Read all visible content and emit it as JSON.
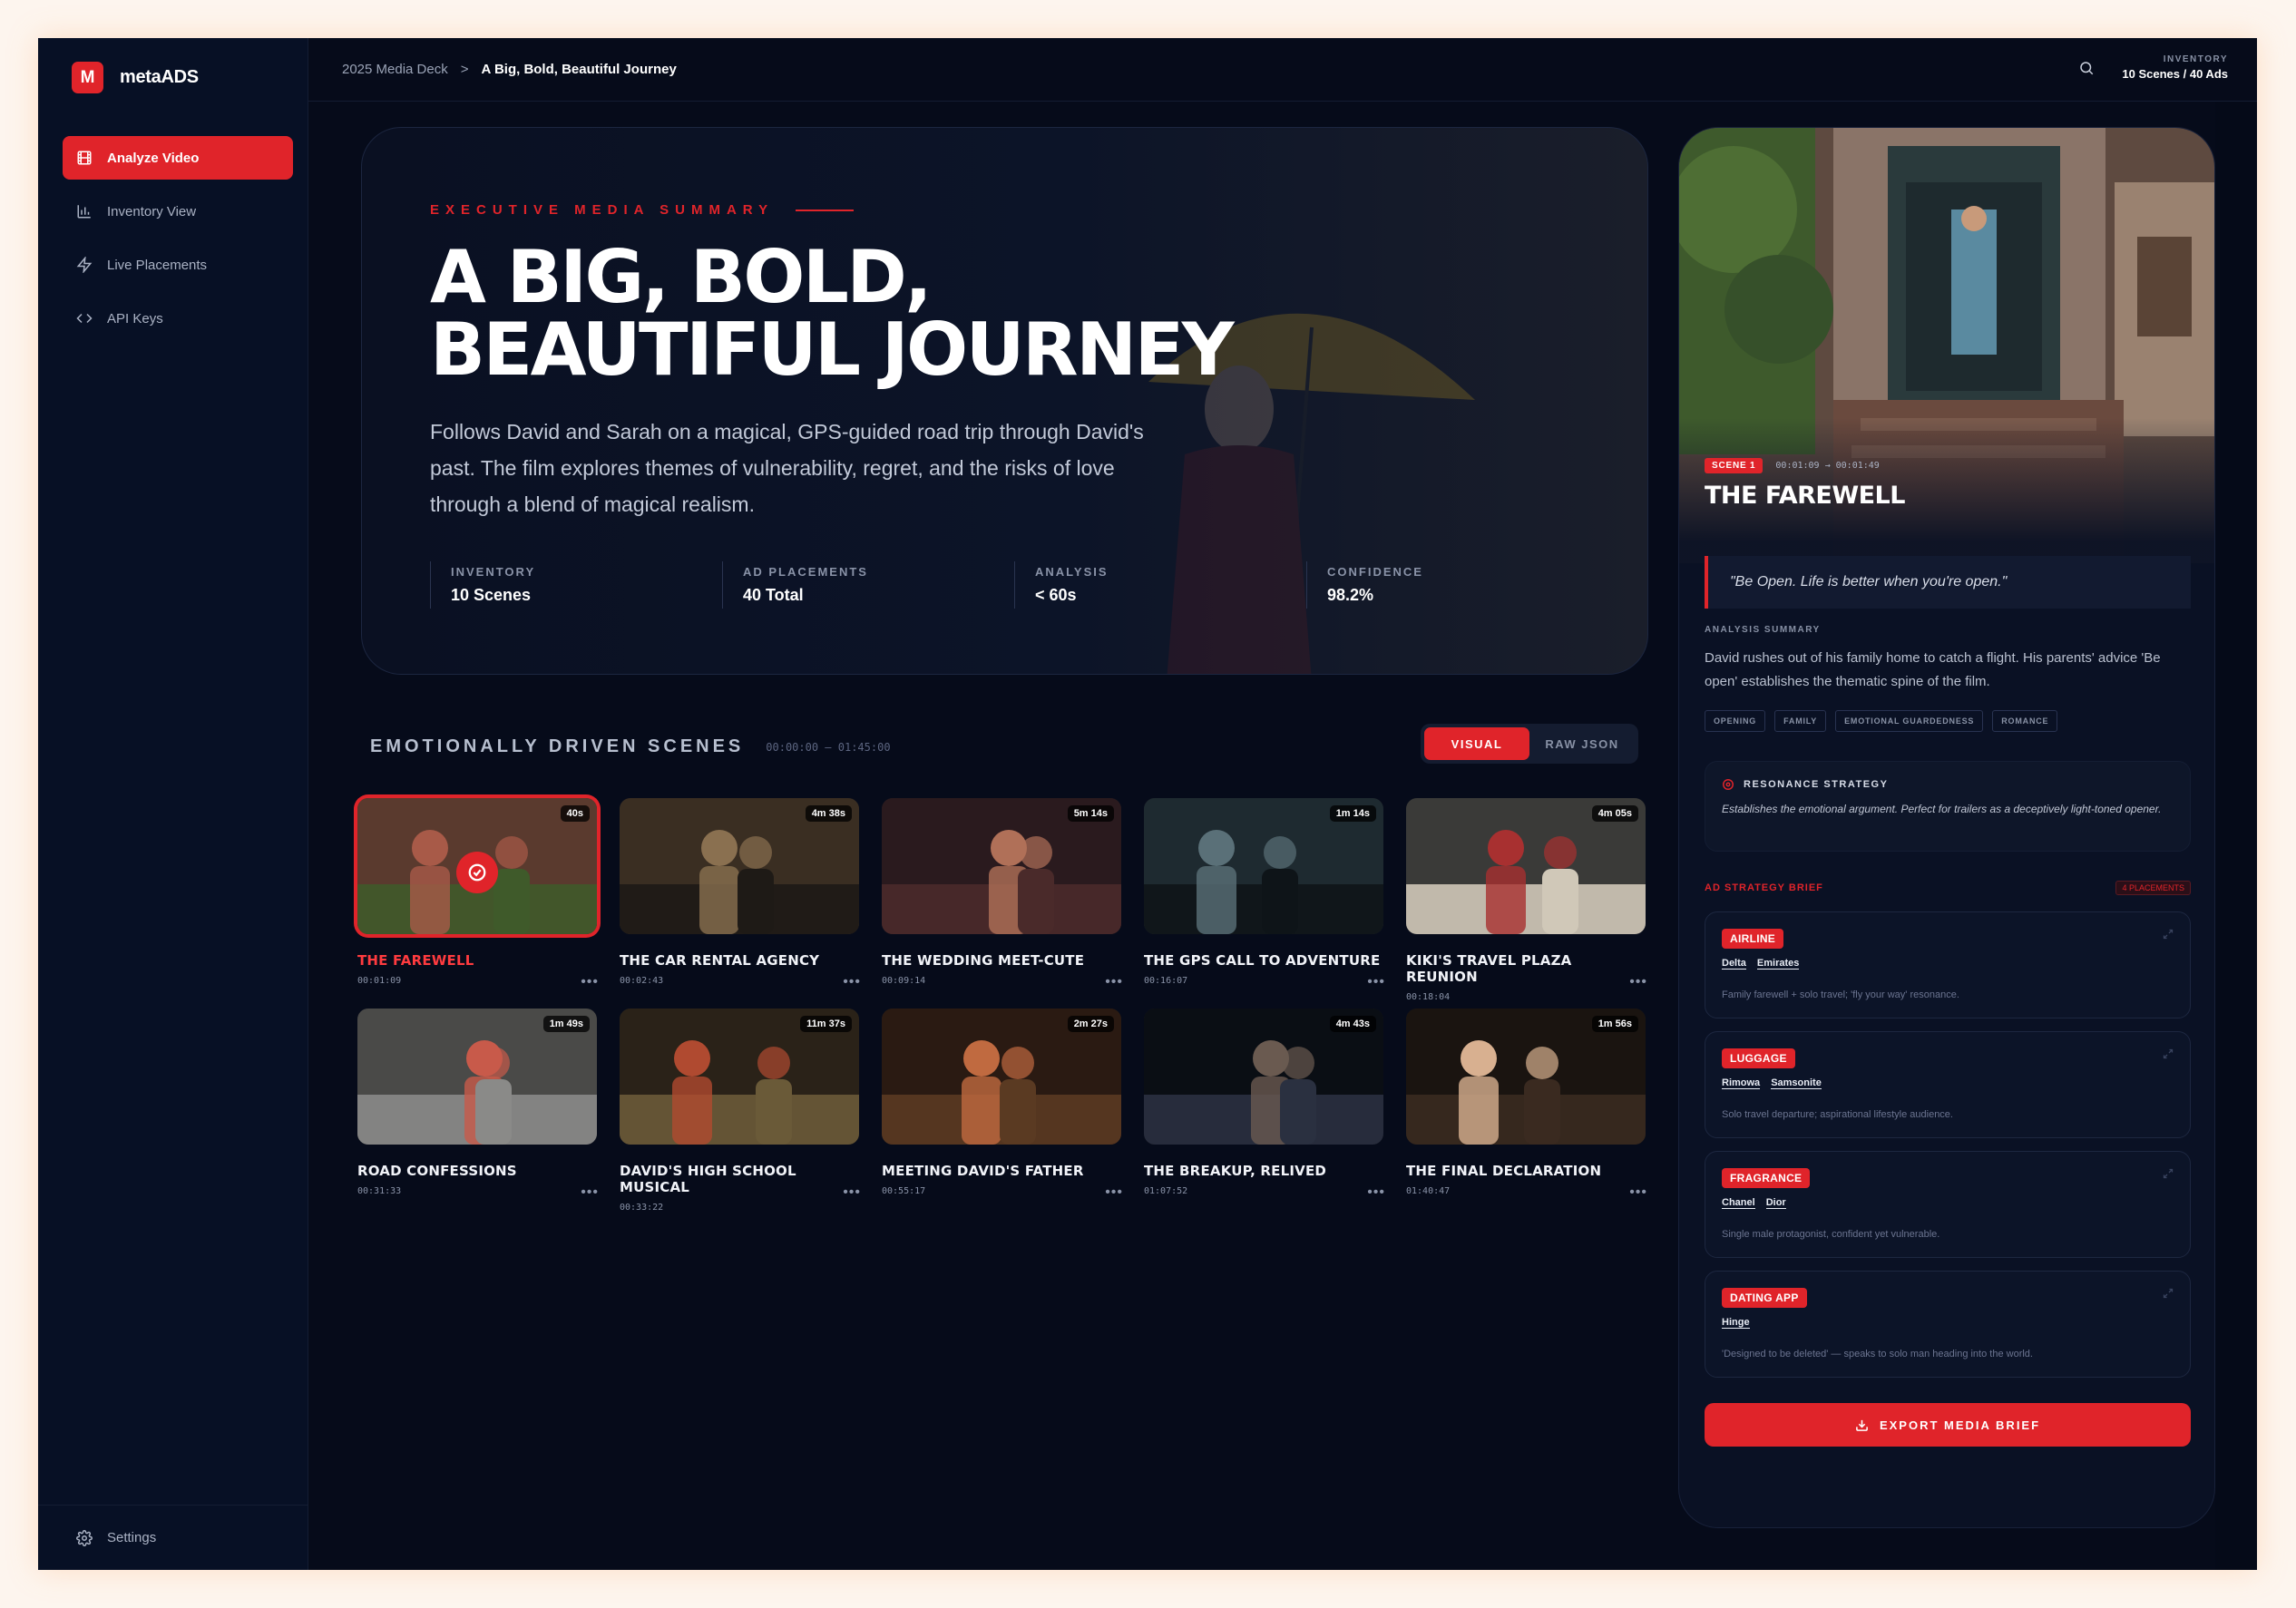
{
  "app": {
    "name": "metaADS",
    "logo_letter": "M"
  },
  "sidebar": {
    "items": [
      {
        "label": "Analyze Video",
        "icon": "film-icon",
        "active": true
      },
      {
        "label": "Inventory View",
        "icon": "bar-chart-icon",
        "active": false
      },
      {
        "label": "Live Placements",
        "icon": "lightning-icon",
        "active": false
      },
      {
        "label": "API Keys",
        "icon": "code-icon",
        "active": false
      }
    ],
    "settings_label": "Settings"
  },
  "header": {
    "breadcrumb_root": "2025 Media Deck",
    "breadcrumb_sep": ">",
    "breadcrumb_current": "A Big, Bold, Beautiful Journey",
    "inventory_label": "INVENTORY",
    "inventory_value": "10 Scenes / 40 Ads"
  },
  "hero": {
    "eyebrow": "EXECUTIVE MEDIA SUMMARY",
    "title": "A BIG, BOLD, BEAUTIFUL JOURNEY",
    "description": "Follows David and Sarah on a magical, GPS-guided road trip through David's past. The film explores themes of vulnerability, regret, and the risks of love through a blend of magical realism.",
    "stats": [
      {
        "label": "INVENTORY",
        "value": "10 Scenes"
      },
      {
        "label": "AD PLACEMENTS",
        "value": "40 Total"
      },
      {
        "label": "ANALYSIS",
        "value": "< 60s"
      },
      {
        "label": "CONFIDENCE",
        "value": "98.2%"
      }
    ]
  },
  "scenes": {
    "title": "EMOTIONALLY DRIVEN SCENES",
    "range": "00:00:00 — 01:45:00",
    "toggle": {
      "visual": "VISUAL",
      "raw": "RAW JSON"
    },
    "more_glyph": "•••",
    "items": [
      {
        "title": "THE FAREWELL",
        "time": "00:01:09",
        "duration": "40s",
        "selected": true,
        "palette": [
          "#5a3a2e",
          "#a85a48",
          "#3f5a2a"
        ]
      },
      {
        "title": "THE CAR RENTAL AGENCY",
        "time": "00:02:43",
        "duration": "4m 38s",
        "selected": false,
        "palette": [
          "#3a2e22",
          "#8a7050",
          "#1e1a16"
        ]
      },
      {
        "title": "THE WEDDING MEET-CUTE",
        "time": "00:09:14",
        "duration": "5m 14s",
        "selected": false,
        "palette": [
          "#2a1a1e",
          "#b07058",
          "#4a2a2a"
        ]
      },
      {
        "title": "THE GPS CALL TO ADVENTURE",
        "time": "00:16:07",
        "duration": "1m 14s",
        "selected": false,
        "palette": [
          "#1e2a30",
          "#5a7078",
          "#0e1418"
        ]
      },
      {
        "title": "KIKI'S TRAVEL PLAZA REUNION",
        "time": "00:18:04",
        "duration": "4m 05s",
        "selected": false,
        "palette": [
          "#3a3a38",
          "#a83030",
          "#d0c8b8"
        ]
      },
      {
        "title": "ROAD CONFESSIONS",
        "time": "00:31:33",
        "duration": "1m 49s",
        "selected": false,
        "palette": [
          "#4a4a48",
          "#c85a4a",
          "#8a8a88"
        ]
      },
      {
        "title": "DAVID'S HIGH SCHOOL MUSICAL",
        "time": "00:33:22",
        "duration": "11m 37s",
        "selected": false,
        "palette": [
          "#2a2218",
          "#b04a30",
          "#6a5a38"
        ]
      },
      {
        "title": "MEETING DAVID'S FATHER",
        "time": "00:55:17",
        "duration": "2m 27s",
        "selected": false,
        "palette": [
          "#2a1a12",
          "#c06a40",
          "#5a3a22"
        ]
      },
      {
        "title": "THE BREAKUP, RELIVED",
        "time": "01:07:52",
        "duration": "4m 43s",
        "selected": false,
        "palette": [
          "#0a0e14",
          "#6a5a50",
          "#2a3040"
        ]
      },
      {
        "title": "THE FINAL DECLARATION",
        "time": "01:40:47",
        "duration": "1m 56s",
        "selected": false,
        "palette": [
          "#1a1410",
          "#d8b090",
          "#3a2a20"
        ]
      }
    ]
  },
  "detail": {
    "badge": "SCENE 1",
    "range": "00:01:09 → 00:01:49",
    "title": "THE FAREWELL",
    "quote": "\"Be Open. Life is better when you're open.\"",
    "summary_label": "ANALYSIS SUMMARY",
    "summary": "David rushes out of his family home to catch a flight. His parents' advice 'Be open' establishes the thematic spine of the film.",
    "tags": [
      "OPENING",
      "FAMILY",
      "EMOTIONAL GUARDEDNESS",
      "ROMANCE"
    ],
    "strategy_label": "RESONANCE STRATEGY",
    "strategy_body": "Establishes the emotional argument. Perfect for trailers as a deceptively light-toned opener.",
    "brief_label": "AD STRATEGY BRIEF",
    "brief_count": "4 PLACEMENTS",
    "placements": [
      {
        "category": "AIRLINE",
        "brands": [
          "Delta",
          "Emirates"
        ],
        "note": "Family farewell + solo travel; 'fly your way' resonance."
      },
      {
        "category": "LUGGAGE",
        "brands": [
          "Rimowa",
          "Samsonite"
        ],
        "note": "Solo travel departure; aspirational lifestyle audience."
      },
      {
        "category": "FRAGRANCE",
        "brands": [
          "Chanel",
          "Dior"
        ],
        "note": "Single male protagonist, confident yet vulnerable."
      },
      {
        "category": "DATING APP",
        "brands": [
          "Hinge"
        ],
        "note": "'Designed to be deleted' — speaks to solo man heading into the world."
      }
    ],
    "export_label": "EXPORT MEDIA BRIEF"
  },
  "colors": {
    "accent": "#e0242a",
    "background": "#060b1a",
    "panel": "#0a1124"
  }
}
